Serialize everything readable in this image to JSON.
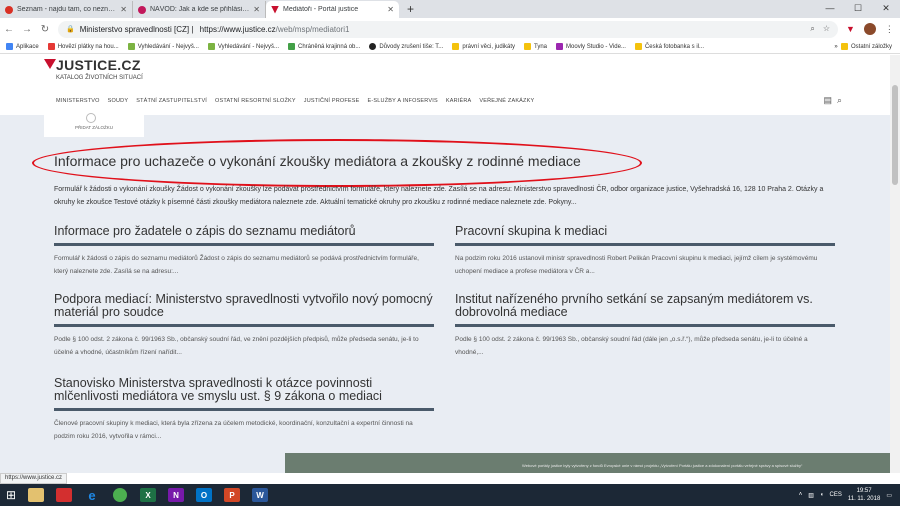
{
  "browser": {
    "tabs": [
      {
        "title": "Seznam - najdu tam, co neznám",
        "color": "#d93025",
        "active": false
      },
      {
        "title": "NÁVOD: Jak a kde se přihlásit n...",
        "color": "#c2185b",
        "active": false
      },
      {
        "title": "Mediátoři - Portál justice",
        "color": "#c8102e",
        "active": true
      }
    ],
    "address_site": "Ministerstvo spravedlnosti [CZ]",
    "address_url_domain": "https://www.justice.cz",
    "address_url_path": "/web/msp/mediatori1",
    "bookmarks": [
      {
        "label": "Aplikace",
        "color": "#4285f4"
      },
      {
        "label": "Hovězí plátky na hou...",
        "color": "#e53935"
      },
      {
        "label": "Vyhledávání - Nejvyš...",
        "color": "#7cb342"
      },
      {
        "label": "Vyhledávání - Nejvyš...",
        "color": "#7cb342"
      },
      {
        "label": "Chráněná krajinná ob...",
        "color": "#43a047"
      },
      {
        "label": "Důvody zrušení tiše: T...",
        "color": "#222222"
      },
      {
        "label": "právní věci, judikáty",
        "color": "#f4c20d"
      },
      {
        "label": "Tyna",
        "color": "#f4c20d"
      },
      {
        "label": "Moovly Studio - Vide...",
        "color": "#9c27b0"
      },
      {
        "label": "Česká fotobanka s il...",
        "color": "#f4c20d"
      }
    ],
    "bookmark_more": "Ostatní záložky",
    "status_url": "https://www.justice.cz"
  },
  "site": {
    "logo_name": "JUSTICE.CZ",
    "logo_sub": "KATALOG ŽIVOTNÍCH SITUACÍ",
    "nav": [
      "MINISTERSTVO",
      "SOUDY",
      "STÁTNÍ ZASTUPITELSTVÍ",
      "OSTATNÍ RESORTNÍ SLOŽKY",
      "JUSTIČNÍ PROFESE",
      "E-SLUŽBY A INFOSERVIS",
      "KARIÉRA",
      "VEŘEJNÉ ZAKÁZKY"
    ],
    "card_label": "PŘIDAT ZÁLOŽKU"
  },
  "main": {
    "title": "Informace pro uchazeče o vykonání zkoušky mediátora a zkoušky z rodinné mediace",
    "intro": "Formulář k žádosti o vykonání zkoušky Žádost o vykonání zkoušky lze podávat prostřednictvím formuláře, který naleznete zde. Zasílá se na adresu: Ministerstvo spravedlnosti ČR, odbor organizace justice, Vyšehradská 16, 128 10 Praha 2. Otázky a okruhy ke zkoušce Testové otázky k písemné části zkoušky mediátora naleznete zde. Aktuální tematické okruhy pro zkoušku z rodinné mediace naleznete zde. Pokyny...",
    "articles": [
      {
        "title": "Informace pro žadatele o zápis do seznamu mediátorů",
        "text": "Formulář k žádosti o zápis do seznamu mediátorů Žádost o zápis do seznamu mediátorů se podává prostřednictvím formuláře, který naleznete zde. Zasílá se na adresu:..."
      },
      {
        "title": "Pracovní skupina k mediaci",
        "text": "Na podzim roku 2016 ustanovil ministr spravedlnosti Robert Pelikán Pracovní skupinu k mediaci, jejímž cílem je systémovému uchopení mediace a profese mediátora v ČR a..."
      },
      {
        "title": "Podpora mediací: Ministerstvo spravedlnosti vytvořilo nový pomocný materiál pro soudce",
        "text": "Podle § 100 odst. 2 zákona č. 99/1963 Sb., občanský soudní řád, ve znění pozdějších předpisů, může předseda senátu, je-li to účelné a vhodné, účastníkům řízení nařídit..."
      },
      {
        "title": "Institut nařízeného prvního setkání se zapsaným mediátorem vs. dobrovolná mediace",
        "text": "Podle § 100 odst. 2 zákona č. 99/1963 Sb., občanský soudní řád (dále jen „o.s.ř.“), může předseda senátu, je-li to účelné a vhodné,..."
      },
      {
        "title": "Stanovisko Ministerstva spravedlnosti k otázce povinnosti mlčenlivosti mediátora ve smyslu ust. § 9 zákona o mediaci",
        "text": "Členové pracovní skupiny k mediaci, která byla zřízena za účelem metodické, koordinační, konzultační a expertní činnosti na podzim roku 2016, vytvořila v rámci..."
      }
    ],
    "footer": "Webové portály justice byly vytvořeny z fondů Evropské unie v rámci projektu „Vytvoření Portálu justice a zdokonalení portálu veřejné správy a spisové služby“"
  },
  "taskbar": {
    "apps": [
      {
        "label": "",
        "color": "#e3c16f"
      },
      {
        "label": "",
        "color": "#d32f2f"
      },
      {
        "label": "e",
        "color": "#1e88e5"
      },
      {
        "label": "",
        "color": "#4caf50"
      },
      {
        "label": "X",
        "color": "#1e7145"
      },
      {
        "label": "N",
        "color": "#7719aa"
      },
      {
        "label": "O",
        "color": "#0072c6"
      },
      {
        "label": "P",
        "color": "#d24726"
      },
      {
        "label": "W",
        "color": "#2b579a"
      }
    ],
    "lang": "CES",
    "time": "19:57",
    "date": "11. 11. 2018"
  }
}
